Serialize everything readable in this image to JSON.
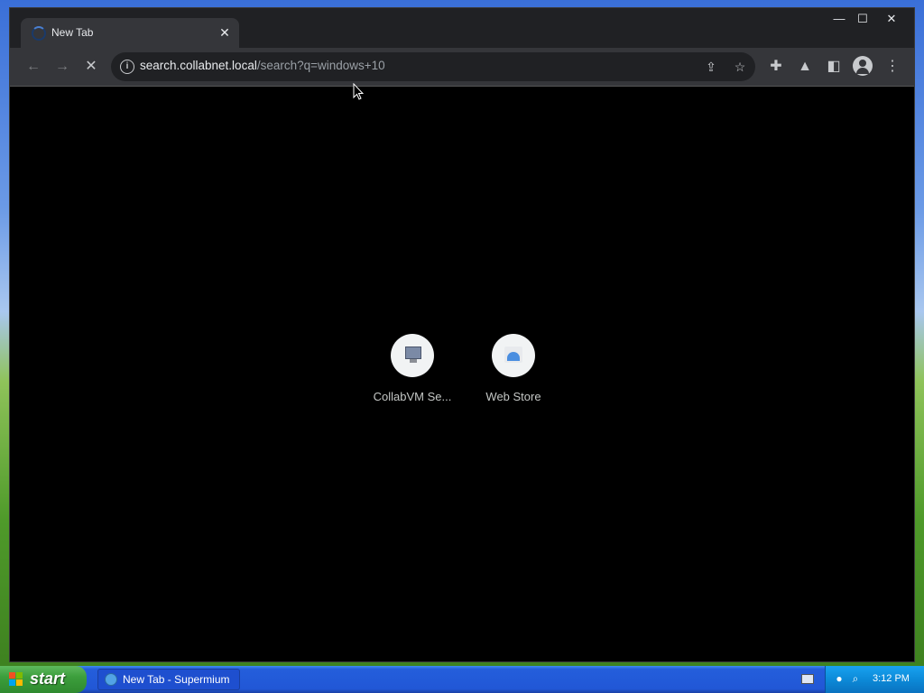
{
  "window": {
    "tab_title": "New Tab",
    "tab_close_glyph": "✕",
    "minimize_glyph": "—",
    "maximize_glyph": "☐",
    "close_glyph": "✕"
  },
  "toolbar": {
    "back_glyph": "←",
    "forward_glyph": "→",
    "stop_glyph": "✕",
    "url_host": "search.collabnet.local",
    "url_path": "/search?q=windows+10",
    "info_glyph": "i",
    "share_glyph": "⇪",
    "bookmark_glyph": "☆",
    "extensions_glyph": "✚",
    "labs_glyph": "▲",
    "sidepanel_glyph": "◧",
    "menu_glyph": "⋮"
  },
  "shortcuts": [
    {
      "label": "CollabVM Se...",
      "icon": "computer-icon"
    },
    {
      "label": "Web Store",
      "icon": "web-store-icon"
    }
  ],
  "taskbar": {
    "start_label": "start",
    "task_button_label": "New Tab - Supermium",
    "clock": "3:12 PM"
  },
  "colors": {
    "browser_frame": "#202124",
    "toolbar": "#35363a",
    "page_background": "#000000",
    "xp_taskbar": "#245edb",
    "xp_start": "#3c9e3c"
  }
}
